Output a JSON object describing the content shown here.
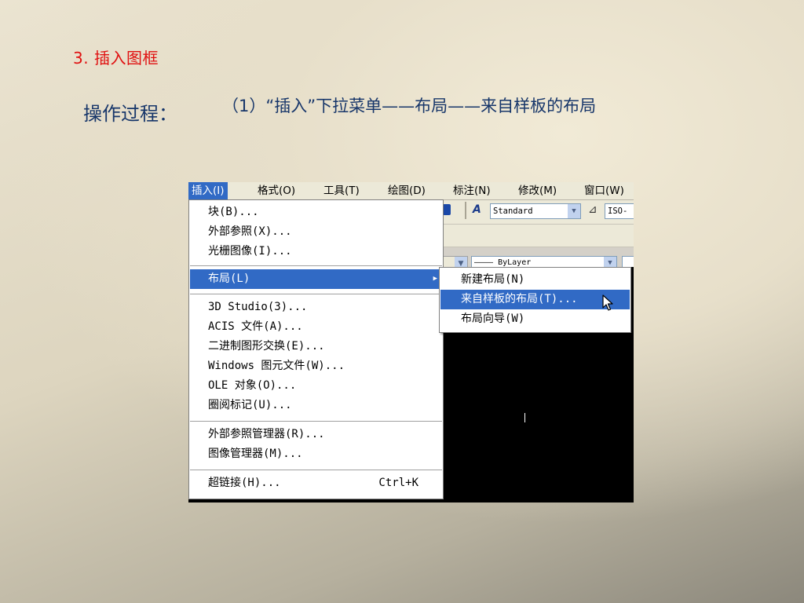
{
  "slide": {
    "title": "3. 插入图框",
    "process_label": "操作过程：",
    "step_text": "（1）“插入”下拉菜单——布局——来自样板的布局"
  },
  "menubar": {
    "items": [
      {
        "label": "插入(I)",
        "active": true
      },
      {
        "label": "格式(O)"
      },
      {
        "label": "工具(T)"
      },
      {
        "label": "绘图(D)"
      },
      {
        "label": "标注(N)"
      },
      {
        "label": "修改(M)"
      },
      {
        "label": "窗口(W)"
      }
    ]
  },
  "toolbar": {
    "text_style": "Standard",
    "dim_style": "ISO-",
    "linetype": "———— ByLayer"
  },
  "insert_menu": {
    "items": [
      {
        "label": "块(B)..."
      },
      {
        "label": "外部参照(X)..."
      },
      {
        "label": "光栅图像(I)..."
      },
      {
        "label": "布局(L)",
        "highlighted": true,
        "has_submenu": true
      },
      {
        "label": "3D Studio(3)..."
      },
      {
        "label": "ACIS 文件(A)..."
      },
      {
        "label": "二进制图形交换(E)..."
      },
      {
        "label": "Windows 图元文件(W)..."
      },
      {
        "label": "OLE 对象(O)..."
      },
      {
        "label": "圈阅标记(U)..."
      },
      {
        "label": "外部参照管理器(R)..."
      },
      {
        "label": "图像管理器(M)..."
      },
      {
        "label": "超链接(H)...",
        "shortcut": "Ctrl+K"
      }
    ]
  },
  "layout_submenu": {
    "items": [
      {
        "label": "新建布局(N)"
      },
      {
        "label": "来自样板的布局(T)...",
        "highlighted": true
      },
      {
        "label": "布局向导(W)"
      }
    ]
  },
  "colors": {
    "title_red": "#e01010",
    "text_navy": "#17366a",
    "menu_highlight": "#316ac5"
  }
}
